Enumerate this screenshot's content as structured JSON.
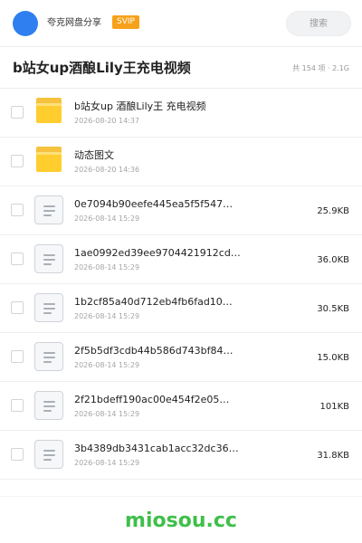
{
  "header": {
    "title": "夸克网盘分享",
    "badge": "SVIP",
    "search_label": "搜索"
  },
  "folder": {
    "title": "b站女up酒酿Lily王充电视频",
    "meta": "共 154 项 · 2.1G"
  },
  "items": [
    {
      "type": "folder",
      "name": "b站女up  酒酿Lily王  充电视频",
      "date": "2026-08-20 14:37",
      "size": ""
    },
    {
      "type": "folder",
      "name": "动态图文",
      "date": "2026-08-20 14:36",
      "size": ""
    },
    {
      "type": "file",
      "name": "0e7094b90eefe445ea5f5f547…",
      "date": "2026-08-14 15:29",
      "size": "25.9KB"
    },
    {
      "type": "file",
      "name": "1ae0992ed39ee9704421912cd…",
      "date": "2026-08-14 15:29",
      "size": "36.0KB"
    },
    {
      "type": "file",
      "name": "1b2cf85a40d712eb4fb6fad10…",
      "date": "2026-08-14 15:29",
      "size": "30.5KB"
    },
    {
      "type": "file",
      "name": "2f5b5df3cdb44b586d743bf84…",
      "date": "2026-08-14 15:29",
      "size": "15.0KB"
    },
    {
      "type": "file",
      "name": "2f21bdeff190ac00e454f2e05…",
      "date": "2026-08-14 15:29",
      "size": "101KB"
    },
    {
      "type": "file",
      "name": "3b4389db3431cab1acc32dc36…",
      "date": "2026-08-14 15:29",
      "size": "31.8KB"
    }
  ],
  "footer": {
    "brand": "miosou.cc"
  },
  "colors": {
    "accent": "#2f7ff0",
    "badge": "#f7a11b",
    "brand": "#3fbf4a",
    "folder": "#ffcd2e"
  }
}
